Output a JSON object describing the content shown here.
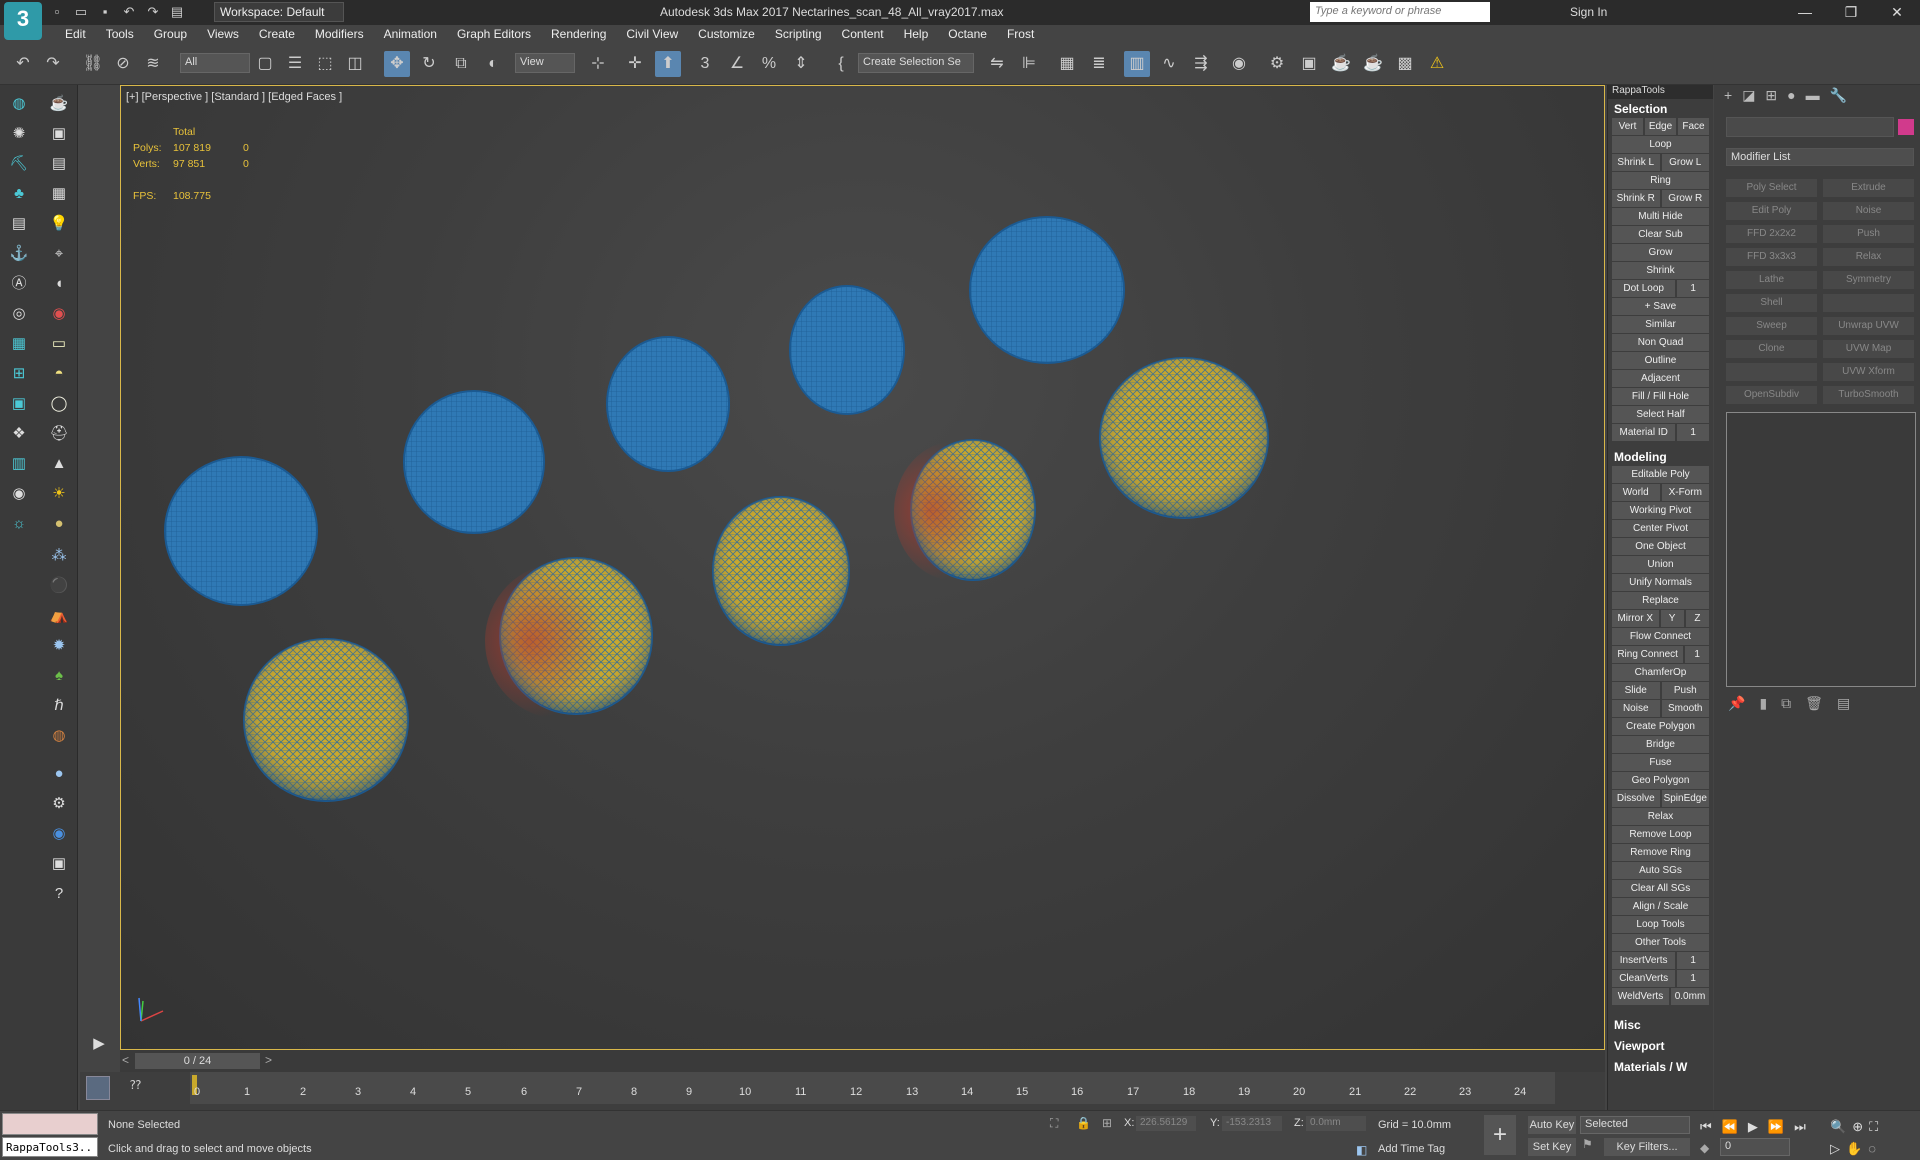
{
  "app": {
    "title": "Autodesk 3ds Max 2017     Nectarines_scan_48_All_vray2017.max",
    "workspace": "Workspace: Default",
    "search_placeholder": "Type a keyword or phrase",
    "sign_in": "Sign In"
  },
  "menu": [
    "Edit",
    "Tools",
    "Group",
    "Views",
    "Create",
    "Modifiers",
    "Animation",
    "Graph Editors",
    "Rendering",
    "Civil View",
    "Customize",
    "Scripting",
    "Content",
    "Help",
    "Octane",
    "Frost"
  ],
  "toolbar": {
    "filter_value": "All",
    "refcoord_value": "View",
    "selection_set": "Create Selection Se"
  },
  "viewport": {
    "label": "[+] [Perspective ] [Standard ] [Edged Faces ]",
    "stats": {
      "total_label": "Total",
      "polys_label": "Polys:",
      "polys_total": "107 819",
      "polys_sel": "0",
      "verts_label": "Verts:",
      "verts_total": "97 851",
      "verts_sel": "0",
      "fps_label": "FPS:",
      "fps_value": "108.775"
    }
  },
  "rappatools": {
    "title": "RappaTools",
    "selection_header": "Selection",
    "vef": [
      "Vert",
      "Edge",
      "Face"
    ],
    "loop": "Loop",
    "shrink_grow_l": [
      "Shrink L",
      "Grow L"
    ],
    "ring": "Ring",
    "shrink_grow_r": [
      "Shrink R",
      "Grow R"
    ],
    "sel_buttons": [
      "Multi Hide",
      "Clear Sub",
      "Grow",
      "Shrink"
    ],
    "dot_loop": "Dot Loop",
    "dot_loop_val": "1",
    "sel_buttons2": [
      "+ Save",
      "Similar",
      "Non Quad",
      "Outline",
      "Adjacent",
      "Fill / Fill Hole",
      "Select Half"
    ],
    "material_id": "Material ID",
    "material_id_val": "1",
    "modeling_header": "Modeling",
    "editable_poly": "Editable Poly",
    "world_xform": [
      "World",
      "X-Form"
    ],
    "mod_buttons": [
      "Working Pivot",
      "Center Pivot",
      "One Object",
      "Union",
      "Unify Normals",
      "Replace"
    ],
    "mirror": [
      "Mirror X",
      "Y",
      "Z"
    ],
    "flow_connect": "Flow Connect",
    "ring_connect": "Ring Connect",
    "ring_connect_val": "1",
    "chamferop": "ChamferOp",
    "slide_push": [
      "Slide",
      "Push"
    ],
    "noise_smooth": [
      "Noise",
      "Smooth"
    ],
    "mod_buttons2": [
      "Create Polygon",
      "Bridge",
      "Fuse",
      "Geo Polygon"
    ],
    "dissolve_spin": [
      "Dissolve",
      "SpinEdge"
    ],
    "mod_buttons3": [
      "Relax",
      "Remove Loop",
      "Remove Ring",
      "Auto SGs",
      "Clear All SGs",
      "Align / Scale",
      "Loop Tools",
      "Other Tools"
    ],
    "insertverts": "InsertVerts",
    "insertverts_val": "1",
    "cleanverts": "CleanVerts",
    "cleanverts_val": "1",
    "weldverts": "WeldVerts",
    "weldverts_val": "0.0mm",
    "misc_header": "Misc",
    "viewport_header": "Viewport",
    "materials_header": "Materials / W"
  },
  "command_panel": {
    "modifier_list": "Modifier List",
    "modifiers": [
      "Poly Select",
      "Extrude",
      "Edit Poly",
      "Noise",
      "FFD 2x2x2",
      "Push",
      "FFD 3x3x3",
      "Relax",
      "Lathe",
      "Symmetry",
      "Shell",
      "",
      "Sweep",
      "Unwrap UVW",
      "Clone",
      "UVW Map",
      "",
      "UVW Xform",
      "OpenSubdiv",
      "TurboSmooth"
    ]
  },
  "timeslider": {
    "value": "0 / 24"
  },
  "trackbar": {
    "ticks": [
      "0",
      "1",
      "2",
      "3",
      "4",
      "5",
      "6",
      "7",
      "8",
      "9",
      "10",
      "11",
      "12",
      "13",
      "14",
      "15",
      "16",
      "17",
      "18",
      "19",
      "20",
      "21",
      "22",
      "23",
      "24"
    ]
  },
  "status": {
    "maxscript": "RappaTools3..",
    "selection": "None Selected",
    "prompt": "Click and drag to select and move objects",
    "x_label": "X:",
    "x_value": "226.56129",
    "y_label": "Y:",
    "y_value": "-153.2313",
    "z_label": "Z:",
    "z_value": "0.0mm",
    "grid": "Grid = 10.0mm",
    "add_time_tag": "Add Time Tag",
    "auto_key": "Auto Key",
    "set_key": "Set Key",
    "selected": "Selected",
    "key_filters": "Key Filters...",
    "frame": "0"
  }
}
